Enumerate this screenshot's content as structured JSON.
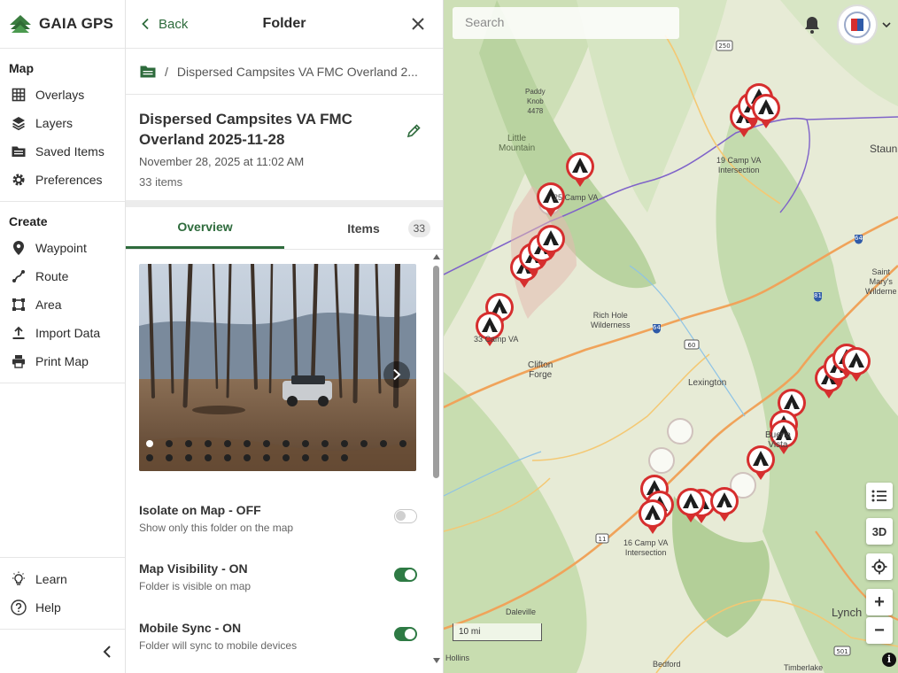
{
  "brand": {
    "name": "GAIA GPS"
  },
  "nav": {
    "map_title": "Map",
    "map_items": [
      {
        "label": "Overlays",
        "icon": "grid-icon"
      },
      {
        "label": "Layers",
        "icon": "layers-icon"
      },
      {
        "label": "Saved Items",
        "icon": "folder-icon"
      },
      {
        "label": "Preferences",
        "icon": "gear-icon"
      }
    ],
    "create_title": "Create",
    "create_items": [
      {
        "label": "Waypoint",
        "icon": "pin-icon"
      },
      {
        "label": "Route",
        "icon": "route-icon"
      },
      {
        "label": "Area",
        "icon": "area-icon"
      },
      {
        "label": "Import Data",
        "icon": "upload-icon"
      },
      {
        "label": "Print Map",
        "icon": "printer-icon"
      }
    ],
    "bottom_items": [
      {
        "label": "Learn",
        "icon": "lightbulb-icon"
      },
      {
        "label": "Help",
        "icon": "help-icon"
      }
    ]
  },
  "panel": {
    "back_label": "Back",
    "title": "Folder",
    "breadcrumb_separator": "/",
    "breadcrumb": "Dispersed Campsites VA FMC Overland 2...",
    "folder_name": "Dispersed Campsites VA FMC Overland 2025-11-28",
    "folder_date": "November 28, 2025 at 11:02 AM",
    "folder_count": "33 items",
    "tabs": {
      "overview": "Overview",
      "items": "Items",
      "items_count": "33"
    },
    "photo_dots": 25,
    "settings": [
      {
        "title": "Isolate on Map - OFF",
        "desc": "Show only this folder on the map",
        "on": false
      },
      {
        "title": "Map Visibility - ON",
        "desc": "Folder is visible on map",
        "on": true
      },
      {
        "title": "Mobile Sync - ON",
        "desc": "Folder will sync to mobile devices",
        "on": true
      }
    ]
  },
  "map": {
    "search_placeholder": "Search",
    "buttons": {
      "three_d": "3D",
      "zoom_in": "+",
      "zoom_out": "−"
    },
    "scale": "10 mi",
    "labels": {
      "camp19": "19 Camp VA\nIntersection",
      "camp25": "25 Camp VA",
      "camp16": "16 Camp VA\nIntersection",
      "camp_sw": "33 Camp VA",
      "lexington": "Lexington",
      "buena_vista": "Buena\nVista",
      "clifton": "Clifton\nForge",
      "rich_hole": "Rich Hole\nWilderness",
      "staunton": "Staun",
      "saint_marys": "Saint\nMary's\nWilderne",
      "lynchburg": "Lynch",
      "daleville": "Daleville",
      "bedford": "Bedford",
      "timberlake": "Timberlake",
      "little_mountain": "Little\nMountain",
      "paddy_knob": "Paddy\nKnob\n4478",
      "hollins": "Hollins"
    },
    "route_numbers": {
      "r250": "250",
      "r64a": "64",
      "r64b": "64",
      "r81": "81",
      "r60": "60",
      "r11": "11",
      "r501": "501"
    },
    "colors": {
      "pin": "#d62e2e",
      "road_major": "#f0a35a",
      "road_state": "#f4c873",
      "boundary": "#7f63c9",
      "forest": "#cfe0b8"
    }
  }
}
